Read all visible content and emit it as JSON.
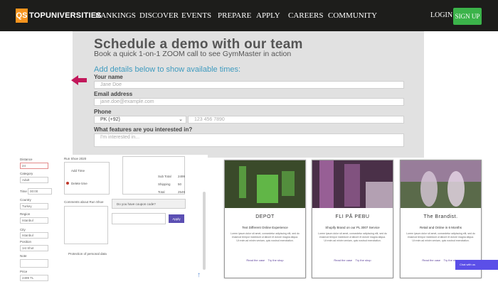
{
  "nav": {
    "logo_abbr": "QS",
    "logo_text": "TOPUNIVERSITIES",
    "items": [
      "RANKINGS",
      "DISCOVER",
      "EVENTS",
      "PREPARE",
      "APPLY",
      "CAREERS",
      "COMMUNITY"
    ],
    "login": "LOGIN",
    "signup": "SIGN UP"
  },
  "demo": {
    "title": "Schedule a demo with our team",
    "subtitle": "Book a quick 1-on-1 ZOOM call to see GymMaster in action",
    "prompt": "Add details below to show available times:",
    "name_label": "Your name",
    "name_placeholder": "Jane Doe",
    "email_label": "Email address",
    "email_placeholder": "jane.doe@example.com",
    "phone_label": "Phone",
    "phone_country": "PK (+92)",
    "phone_placeholder": "123 456 7890",
    "features_label": "What features are you interested in?",
    "features_placeholder": "I'm interested in..."
  },
  "left_form": {
    "fields": [
      {
        "label": "Distance",
        "value": "24"
      },
      {
        "label": "Category",
        "value": "Adult"
      },
      {
        "label": "Time",
        "value": "00:00"
      },
      {
        "label": "Country",
        "value": "Turkey"
      },
      {
        "label": "Region",
        "value": "Istanbul"
      },
      {
        "label": "City",
        "value": "Istanbul"
      },
      {
        "label": "Position",
        "value": "1st Shot"
      },
      {
        "label": "Note",
        "value": ""
      },
      {
        "label": "Price",
        "value": "2499 TL"
      }
    ],
    "options": [
      "Add Time",
      "Delete time"
    ],
    "textarea_label": "Comments about Run Shoe",
    "product_name": "Run Shoe 2020",
    "rows": [
      {
        "label": "Sub Total",
        "value": "2499"
      },
      {
        "label": "Shipping",
        "value": "50"
      },
      {
        "label": "Total",
        "value": "2549"
      }
    ],
    "coupon_label": "Do you have coupon code?",
    "apply": "Apply",
    "footer_note": "Protection of personal data"
  },
  "cards": [
    {
      "brand": "DEPOT",
      "heading": "Text Different Online Experience",
      "body": "Lorem ipsum dolor sit amet, consectetur adipiscing elit, sed do eiusmod tempor incididunt ut labore et dolore magna aliqua. Ut enim ad minim veniam, quis nostrud exercitation.",
      "link1": "Read the case",
      "link2": "Try the shop",
      "color_a": "#3a4a2a",
      "color_b": "#6bd14f"
    },
    {
      "brand": "FLI PÅ PEBU",
      "heading": "Shopify Brand on our PL 3007 Service",
      "body": "Lorem ipsum dolor sit amet, consectetur adipiscing elit, sed do eiusmod tempor incididunt ut labore et dolore magna aliqua. Ut enim ad minim veniam, quis nostrud exercitation.",
      "link1": "Read the case",
      "link2": "Try the shop",
      "color_a": "#4a3048",
      "color_b": "#b874b6"
    },
    {
      "brand": "The Brandist.",
      "heading": "Retail and Online in 6 Months",
      "body": "Lorem ipsum dolor sit amet, consectetur adipiscing elit, sed do eiusmod tempor incididunt ut labore et dolore magna aliqua. Ut enim ad minim veniam, quis nostrud exercitation.",
      "link1": "Read the case",
      "link2": "Try the shop",
      "color_a": "#5a6a4a",
      "color_b": "#c28ad0"
    }
  ],
  "float_button": "Chat with us"
}
